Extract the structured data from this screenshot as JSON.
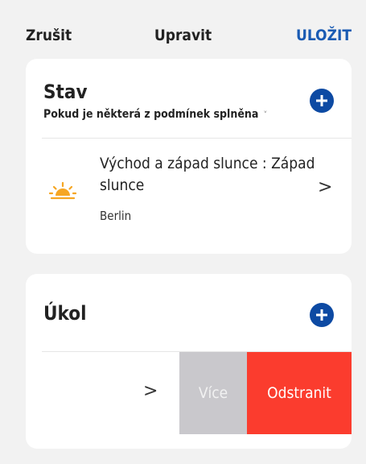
{
  "header": {
    "cancel_label": "Zrušit",
    "title": "Upravit",
    "save_label": "ULOŽIT"
  },
  "condition_card": {
    "title": "Stav",
    "mode_label": "Pokud je některá z podmínek splněna",
    "caret": "˅",
    "condition": {
      "icon": "sunset-icon",
      "label": "Východ a západ slunce : Západ slunce",
      "location": "Berlin",
      "chevron": ">"
    }
  },
  "task_card": {
    "title": "Úkol",
    "row_chevron": ">",
    "more_label": "Více",
    "delete_label": "Odstranit"
  },
  "colors": {
    "accent": "#0d4aa3",
    "save_text": "#1a5bb3",
    "delete": "#fb3c2e",
    "more": "#c9c8cc",
    "sun": "#f6a623"
  }
}
